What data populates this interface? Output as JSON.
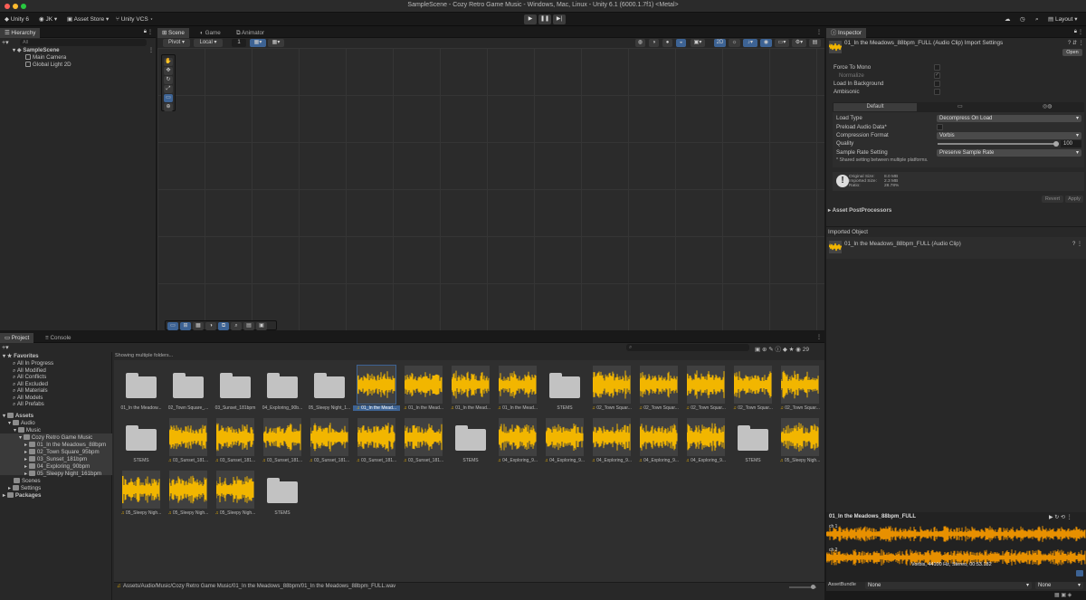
{
  "window": {
    "title": "SampleScene - Cozy Retro Game Music - Windows, Mac, Linux - Unity 6.1 (6000.1.7f1) <Metal>"
  },
  "toolbar": {
    "unity": "Unity 6",
    "account": "JK",
    "asset_store": "Asset Store",
    "vcs": "Unity VCS",
    "layout": "Layout"
  },
  "hierarchy": {
    "tab": "Hierarchy",
    "search_placeholder": "All",
    "scene": "SampleScene",
    "items": [
      "Main Camera",
      "Global Light 2D"
    ]
  },
  "scene_tabs": [
    "Scene",
    "Game",
    "Animator"
  ],
  "scene_toolbar": {
    "pivot": "Pivot",
    "local": "Local",
    "snap": "1",
    "mode_2d": "2D"
  },
  "project": {
    "tabs": [
      "Project",
      "Console"
    ],
    "count": "29",
    "status": "Showing multiple folders...",
    "favorites_label": "Favorites",
    "favorites": [
      "All In Progress",
      "All Modified",
      "All Conflicts",
      "All Excluded",
      "All Materials",
      "All Models",
      "All Prefabs"
    ],
    "assets_label": "Assets",
    "tree": [
      "Audio",
      "Music",
      "Cozy Retro Game Music",
      "01_In the Meadows_88bpm",
      "02_Town Square_95bpm",
      "03_Sunset_181bpm",
      "04_Exploring_90bpm",
      "05_Sleepy Night_161bpm",
      "Scenes",
      "Settings"
    ],
    "packages_label": "Packages",
    "grid": [
      {
        "cap": "01_In the Meadow...",
        "kind": "folder"
      },
      {
        "cap": "02_Town Square_...",
        "kind": "folder"
      },
      {
        "cap": "03_Sunset_181bpm",
        "kind": "folder"
      },
      {
        "cap": "04_Exploring_90b...",
        "kind": "folder"
      },
      {
        "cap": "05_Sleepy Night_1...",
        "kind": "folder"
      },
      {
        "cap": "01_In the Mead...",
        "kind": "audio",
        "selected": true
      },
      {
        "cap": "01_In the Mead...",
        "kind": "audio"
      },
      {
        "cap": "01_In the Mead...",
        "kind": "audio"
      },
      {
        "cap": "01_In the Mead...",
        "kind": "audio"
      },
      {
        "cap": "STEMS",
        "kind": "folder"
      },
      {
        "cap": "02_Town Squar...",
        "kind": "audio"
      },
      {
        "cap": "02_Town Squar...",
        "kind": "audio"
      },
      {
        "cap": "02_Town Squar...",
        "kind": "audio"
      },
      {
        "cap": "02_Town Squar...",
        "kind": "audio"
      },
      {
        "cap": "02_Town Squar...",
        "kind": "audio"
      },
      {
        "cap": "STEMS",
        "kind": "folder"
      },
      {
        "cap": "03_Sunset_181...",
        "kind": "audio"
      },
      {
        "cap": "03_Sunset_181...",
        "kind": "audio"
      },
      {
        "cap": "03_Sunset_181...",
        "kind": "audio"
      },
      {
        "cap": "03_Sunset_181...",
        "kind": "audio"
      },
      {
        "cap": "03_Sunset_181...",
        "kind": "audio"
      },
      {
        "cap": "03_Sunset_181...",
        "kind": "audio"
      },
      {
        "cap": "STEMS",
        "kind": "folder"
      },
      {
        "cap": "04_Exploring_9...",
        "kind": "audio"
      },
      {
        "cap": "04_Exploring_9...",
        "kind": "audio"
      },
      {
        "cap": "04_Exploring_9...",
        "kind": "audio"
      },
      {
        "cap": "04_Exploring_9...",
        "kind": "audio"
      },
      {
        "cap": "04_Exploring_9...",
        "kind": "audio"
      },
      {
        "cap": "STEMS",
        "kind": "folder"
      },
      {
        "cap": "05_Sleepy Nigh...",
        "kind": "audio"
      },
      {
        "cap": "05_Sleepy Nigh...",
        "kind": "audio"
      },
      {
        "cap": "05_Sleepy Nigh...",
        "kind": "audio"
      },
      {
        "cap": "05_Sleepy Nigh...",
        "kind": "audio"
      },
      {
        "cap": "STEMS",
        "kind": "folder"
      }
    ],
    "path": "Assets/Audio/Music/Cozy Retro Game Music/01_In the Meadows_88bpm/01_In the Meadows_88bpm_FULL.wav"
  },
  "inspector": {
    "tab": "Inspector",
    "header": "01_In the Meadows_88bpm_FULL (Audio Clip) Import Settings",
    "open": "Open",
    "force_to_mono": "Force To Mono",
    "normalize": "Normalize",
    "load_in_background": "Load In Background",
    "ambisonic": "Ambisonic",
    "platform_default": "Default",
    "load_type_label": "Load Type",
    "load_type": "Decompress On Load",
    "preload_label": "Preload Audio Data*",
    "compression_label": "Compression Format",
    "compression": "Vorbis",
    "quality_label": "Quality",
    "quality": "100",
    "quality_fraction": 1.0,
    "sample_rate_label": "Sample Rate Setting",
    "sample_rate": "Preserve Sample Rate",
    "shared_note": "* Shared setting between multiple platforms.",
    "stats_labels": [
      "Original Size:",
      "Imported Size:",
      "Ratio:"
    ],
    "stats_values": [
      "8.0 MB",
      "2.3 MB",
      "28.78%"
    ],
    "revert": "Revert",
    "apply": "Apply",
    "postprocessors": "Asset PostProcessors",
    "imported_object": "Imported Object",
    "imported_name": "01_In the Meadows_88bpm_FULL (Audio Clip)",
    "preview_title": "01_In the Meadows_88bpm_FULL",
    "ch1": "ch 1",
    "ch2": "ch 2",
    "preview_info": "Vorbis, 44100 Hz, Stereo, 00:53.182",
    "assetbundle_label": "AssetBundle",
    "assetbundle": "None",
    "assetbundle_variant": "None"
  },
  "colors": {
    "accent": "#3d6394",
    "wave": "#f2b600",
    "wave_preview": "#e89000"
  }
}
